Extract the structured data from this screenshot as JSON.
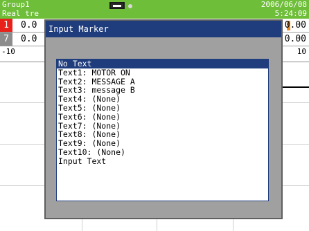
{
  "status_bar": {
    "group": "Group1",
    "mode": "Real tre",
    "date": "2006/06/08",
    "time": "5:24:09"
  },
  "channels": [
    {
      "number": "1",
      "value": "0.0",
      "right_value": "0.00",
      "color": "#e8211b"
    },
    {
      "number": "7",
      "value": "0.0",
      "right_value": "0.00",
      "color": "#8c8c8c"
    }
  ],
  "scale": {
    "left": "-10",
    "right": "10"
  },
  "dialog": {
    "title": "Input Marker",
    "items": [
      "No Text",
      "Text1: MOTOR ON",
      "Text2: MESSAGE A",
      "Text3: message B",
      "Text4: (None)",
      "Text5: (None)",
      "Text6: (None)",
      "Text7: (None)",
      "Text8: (None)",
      "Text9: (None)",
      "Text10: (None)",
      "Input Text"
    ],
    "selected_index": 0
  }
}
